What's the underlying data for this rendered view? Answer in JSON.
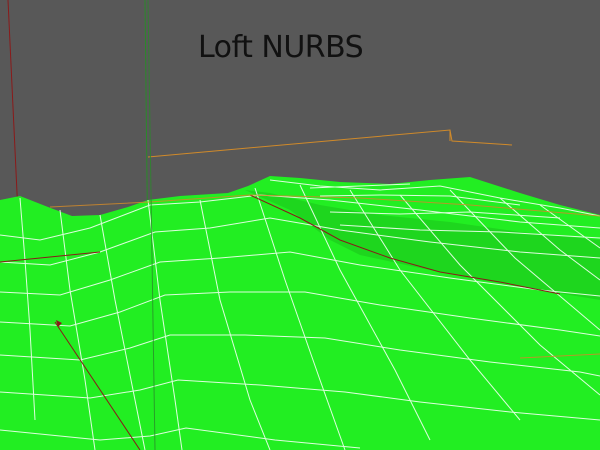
{
  "viewport": {
    "title": "Loft NURBS",
    "colors": {
      "background": "#585858",
      "surface": "#22ee22",
      "surface_shade": "#1ccc1c",
      "wireframe": "#e8ffe8",
      "axis_red": "#8a1a1a",
      "axis_green": "#2a8a2a",
      "spline_orange": "#d08a2a"
    }
  }
}
